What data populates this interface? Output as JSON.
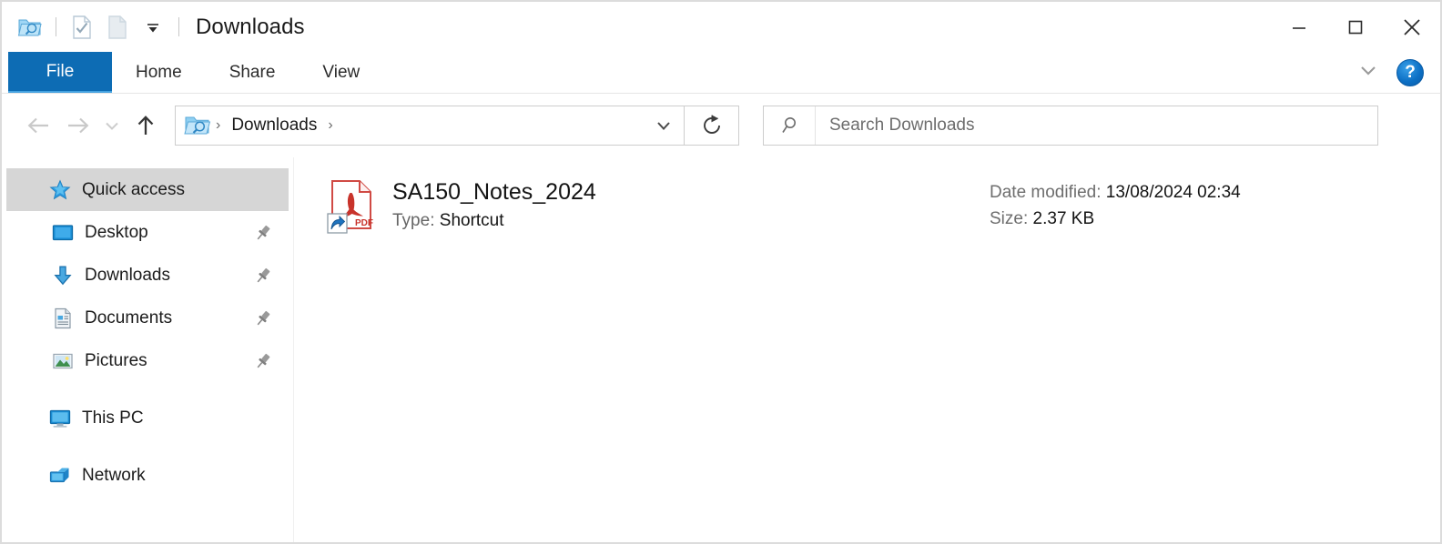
{
  "window": {
    "title": "Downloads",
    "quick_access_toolbar": [
      {
        "name": "downloads-folder-icon",
        "label": "Downloads"
      },
      {
        "name": "properties-icon",
        "label": "Properties"
      },
      {
        "name": "new-folder-icon",
        "label": "New folder"
      },
      {
        "name": "customize-qat-chevron-icon",
        "label": "Customize Quick Access Toolbar"
      }
    ],
    "controls": {
      "minimize": "—",
      "maximize": "☐",
      "close": "✕"
    }
  },
  "ribbon": {
    "tabs": [
      {
        "label": "File",
        "active": true
      },
      {
        "label": "Home",
        "active": false
      },
      {
        "label": "Share",
        "active": false
      },
      {
        "label": "View",
        "active": false
      }
    ],
    "expand_label": "Expand the Ribbon",
    "help_label": "?"
  },
  "navbar": {
    "back_label": "Back",
    "forward_label": "Forward",
    "recent_label": "Recent locations",
    "up_label": "Up",
    "breadcrumbs": [
      {
        "label": "Downloads"
      }
    ],
    "separator": "›",
    "history_dropdown_label": "Previous locations",
    "refresh_label": "Refresh"
  },
  "search": {
    "placeholder": "Search Downloads",
    "value": "",
    "icon": "search-icon"
  },
  "sidebar": {
    "items": [
      {
        "label": "Quick access",
        "icon": "quick-access-star-icon",
        "selected": true,
        "pinned": false,
        "level": 0
      },
      {
        "label": "Desktop",
        "icon": "desktop-icon",
        "selected": false,
        "pinned": true,
        "level": 1
      },
      {
        "label": "Downloads",
        "icon": "downloads-arrow-icon",
        "selected": false,
        "pinned": true,
        "level": 1
      },
      {
        "label": "Documents",
        "icon": "documents-icon",
        "selected": false,
        "pinned": true,
        "level": 1
      },
      {
        "label": "Pictures",
        "icon": "pictures-icon",
        "selected": false,
        "pinned": true,
        "level": 1
      },
      {
        "label": "This PC",
        "icon": "this-pc-icon",
        "selected": false,
        "pinned": false,
        "level": 0
      },
      {
        "label": "Network",
        "icon": "network-icon",
        "selected": false,
        "pinned": false,
        "level": 0
      }
    ]
  },
  "file_list": {
    "items": [
      {
        "name": "SA150_Notes_2024",
        "type_label": "Type:",
        "type_value": "Shortcut",
        "date_label": "Date modified:",
        "date_value": "13/08/2024 02:34",
        "size_label": "Size:",
        "size_value": "2.37 KB",
        "icon": "pdf-shortcut-icon"
      }
    ]
  },
  "colors": {
    "file_tab_blue": "#0d6cb4",
    "selection_gray": "#d6d6d6",
    "help_blue": "#0c6fc4",
    "pdf_red": "#c8332b",
    "folder_blue": "#60b6e8"
  }
}
